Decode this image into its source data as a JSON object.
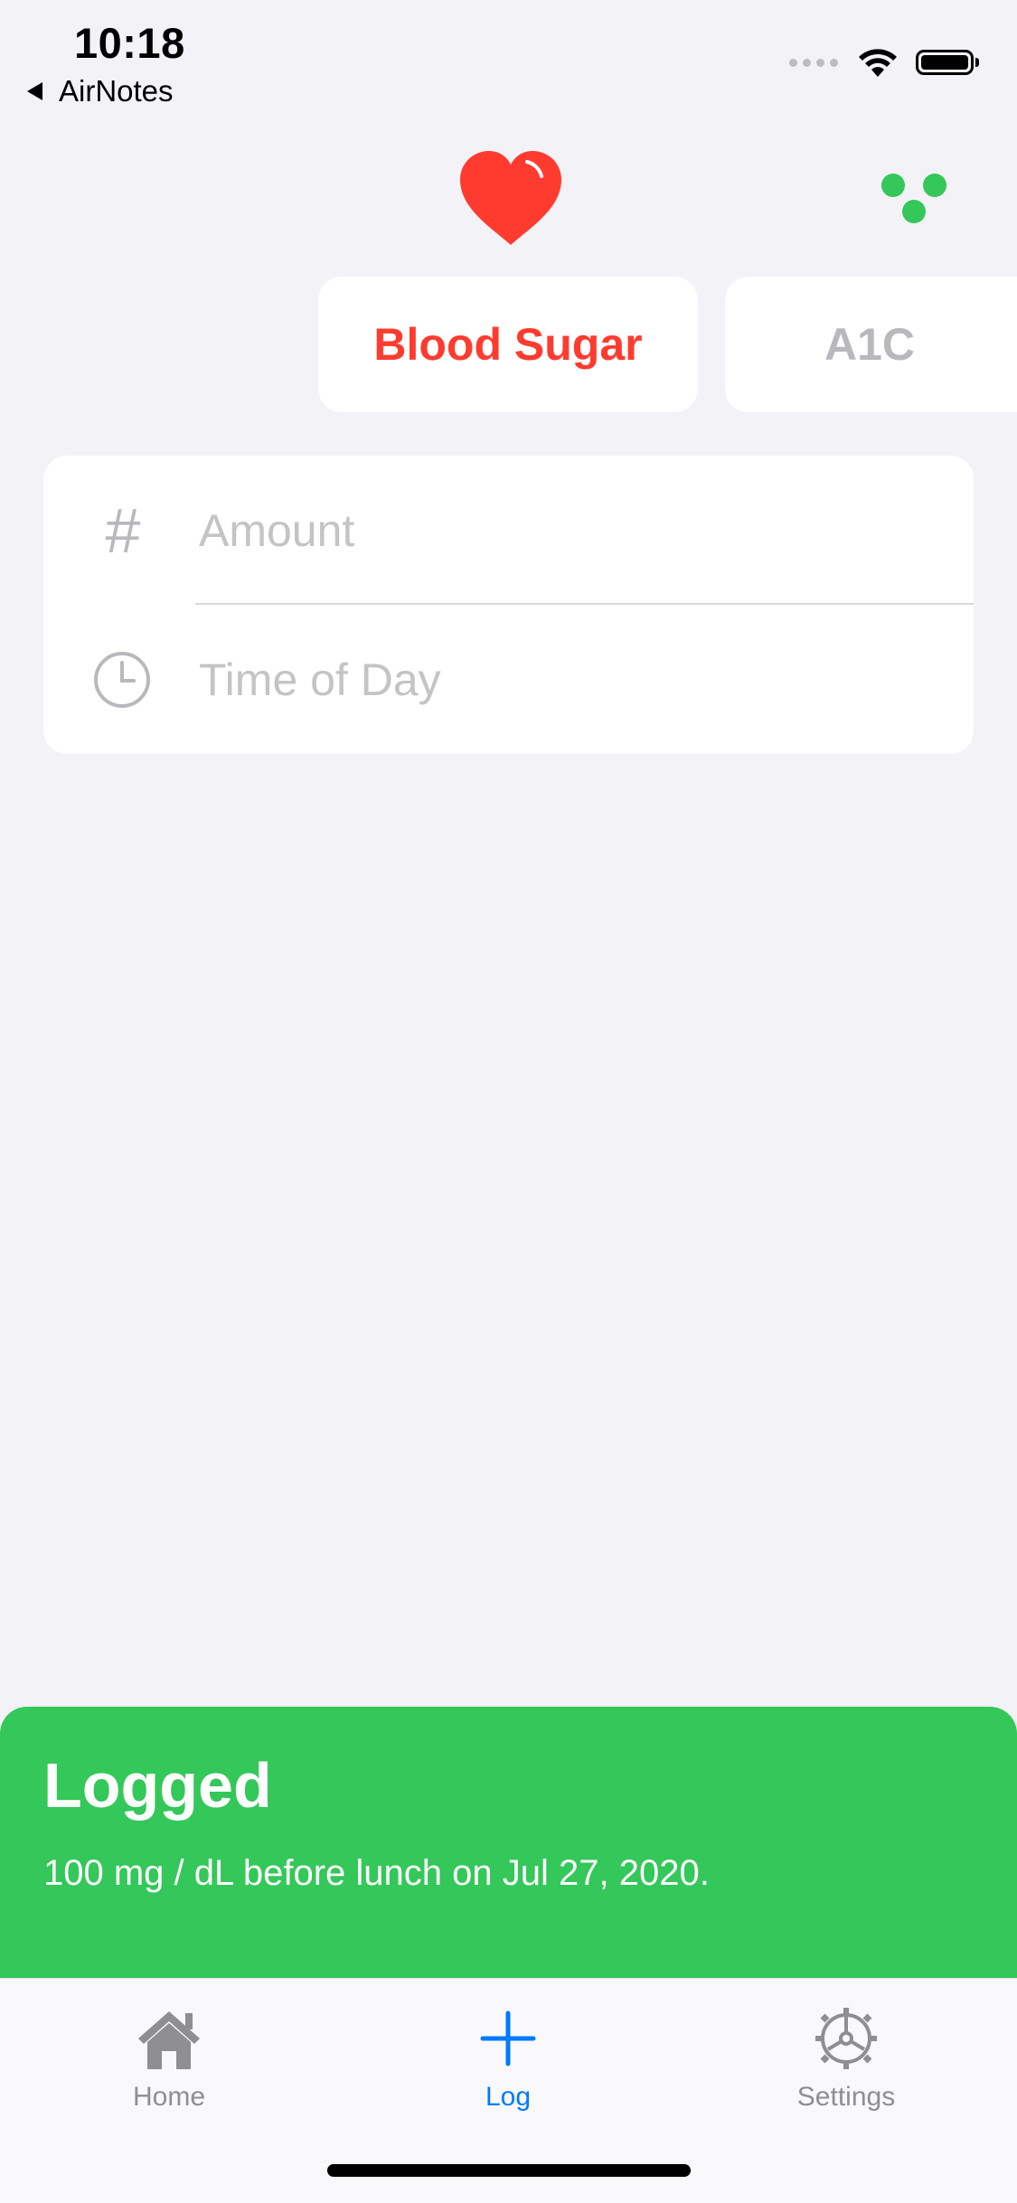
{
  "status_bar": {
    "time": "10:18",
    "back_label": "AirNotes"
  },
  "header": {
    "heart_icon": "heart-icon",
    "dots_icon": "three-dots-icon",
    "heart_color": "#ff3b30",
    "dots_color": "#34c759"
  },
  "segments": [
    {
      "label": "Blood Sugar",
      "selected": true,
      "color": "#ff3b30"
    },
    {
      "label": "A1C",
      "selected": false,
      "color": "#b8b8bd"
    }
  ],
  "form": {
    "amount": {
      "icon": "hash-icon",
      "placeholder": "Amount",
      "value": ""
    },
    "time_of_day": {
      "icon": "clock-icon",
      "placeholder": "Time of Day",
      "value": ""
    }
  },
  "toast": {
    "title": "Logged",
    "message": "100 mg / dL before lunch on Jul 27, 2020.",
    "color": "#34c759"
  },
  "tab_bar": {
    "tabs": [
      {
        "label": "Home",
        "icon": "house-icon",
        "active": false
      },
      {
        "label": "Log",
        "icon": "plus-icon",
        "active": true
      },
      {
        "label": "Settings",
        "icon": "gear-icon",
        "active": false
      }
    ],
    "active_color": "#007aff",
    "inactive_color": "#8e8e93"
  }
}
